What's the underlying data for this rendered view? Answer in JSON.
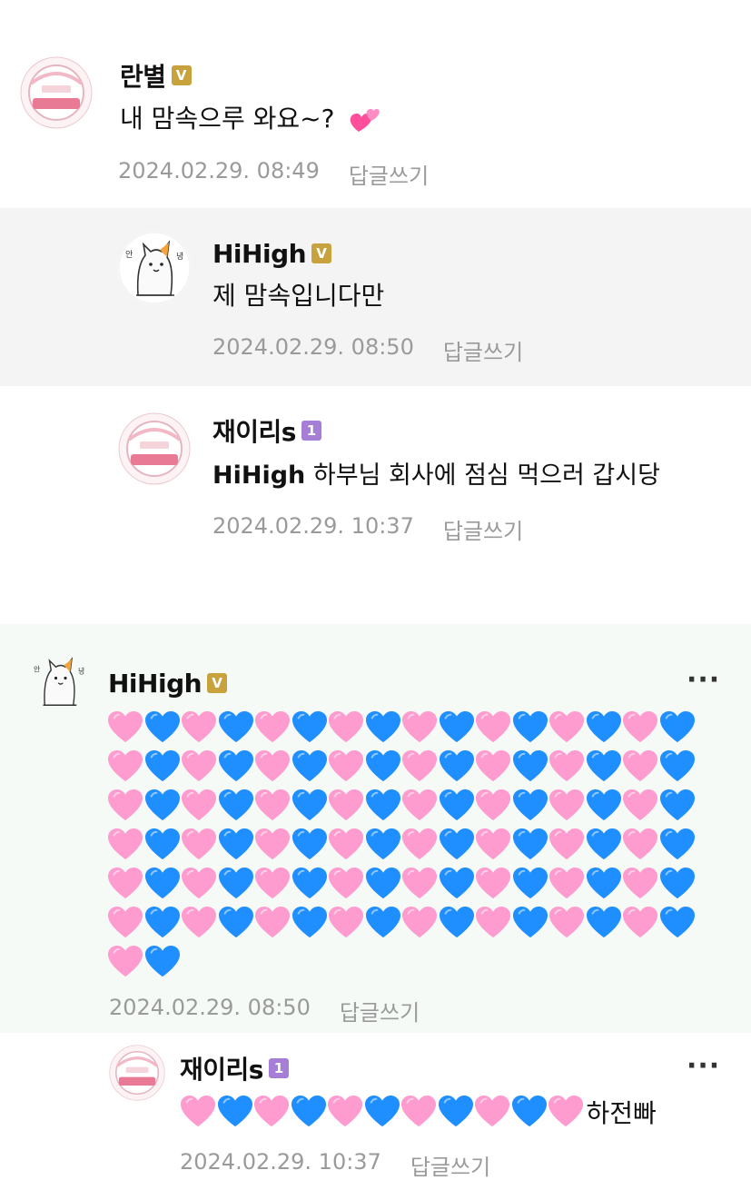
{
  "comments": [
    {
      "author": "란별",
      "badge": "V",
      "badge_color": "#c8a23c",
      "text": "내 맘속으루 와요~?",
      "emoji": "💕",
      "timestamp": "2024.02.29. 08:49",
      "reply_label": "답글쓰기"
    },
    {
      "author": "HiHigh",
      "badge": "V",
      "badge_color": "#c8a23c",
      "text": "제 맘속입니다만",
      "timestamp": "2024.02.29. 08:50",
      "reply_label": "답글쓰기",
      "background": "#f4f4f4"
    },
    {
      "author": "재이리s",
      "badge": "1",
      "badge_color": "#a77ed6",
      "mention": "HiHigh",
      "text": "하부님 회사에 점심 먹으러 갑시당",
      "timestamp": "2024.02.29. 10:37",
      "reply_label": "답글쓰기"
    },
    {
      "author": "HiHigh",
      "badge": "V",
      "badge_color": "#c8a23c",
      "hearts": {
        "pairs_per_row": 8,
        "full_rows": 6,
        "last_row_pairs": 1
      },
      "timestamp": "2024.02.29. 08:50",
      "reply_label": "답글쓰기",
      "more_label": "···",
      "background": "#f5faf7"
    },
    {
      "author": "재이리s",
      "badge": "1",
      "badge_color": "#a77ed6",
      "hearts_inline": 11,
      "tail_text": "하전빠",
      "timestamp": "2024.02.29. 10:37",
      "reply_label": "답글쓰기",
      "more_label": "···"
    }
  ],
  "icons": {
    "pink_heart": "pink-heart-icon",
    "blue_heart": "blue-heart-icon",
    "two_hearts": "two-hearts-icon",
    "avatar_badge": "first-lover-badge-avatar",
    "avatar_cat": "cat-character-avatar"
  },
  "colors": {
    "pink": "#ff9ccf",
    "blue": "#1f8fff",
    "meta": "#9a9a9a"
  }
}
